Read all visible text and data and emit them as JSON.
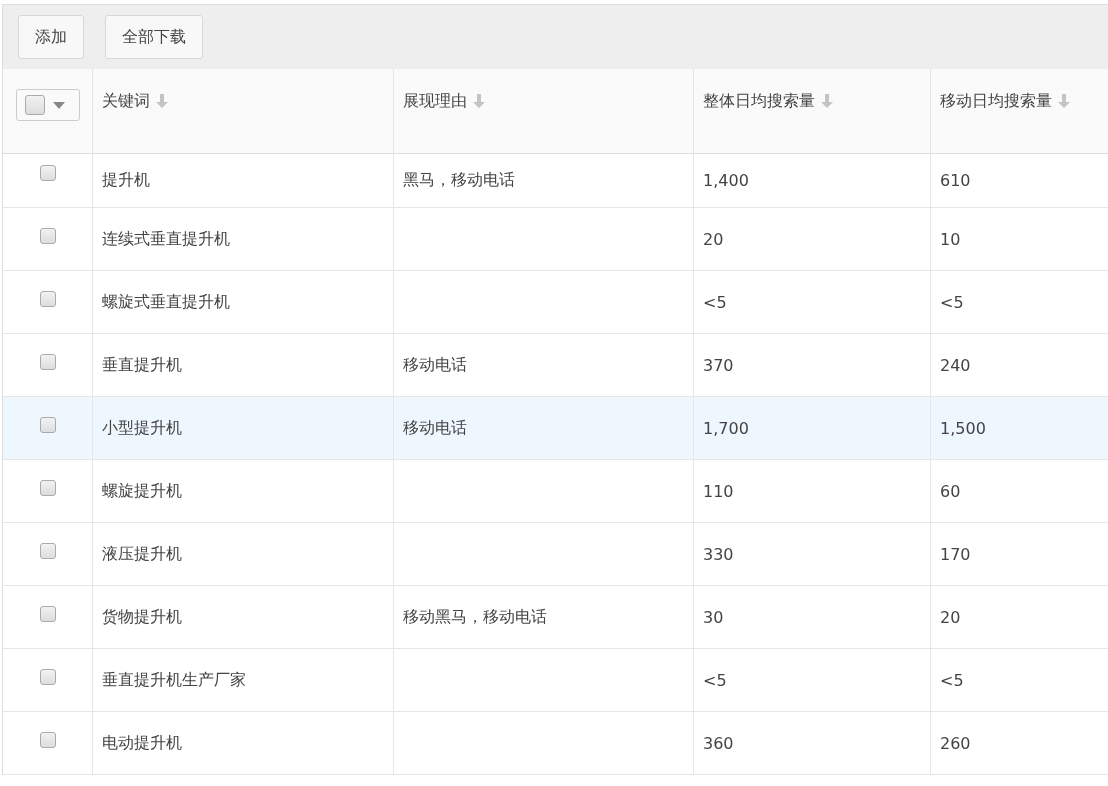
{
  "toolbar": {
    "buttons": [
      "添加",
      "全部下载"
    ]
  },
  "table": {
    "select_all": {
      "checked": false
    },
    "columns": [
      {
        "label": "关键词"
      },
      {
        "label": "展现理由"
      },
      {
        "label": "整体日均搜索量"
      },
      {
        "label": "移动日均搜索量"
      }
    ],
    "rows": [
      {
        "checked": false,
        "hovered": false,
        "cells": [
          "提升机",
          "黑马，移动电话",
          "1,400",
          "610"
        ]
      },
      {
        "checked": false,
        "hovered": false,
        "cells": [
          "连续式垂直提升机",
          "",
          "20",
          "10"
        ]
      },
      {
        "checked": false,
        "hovered": false,
        "cells": [
          "螺旋式垂直提升机",
          "",
          "<5",
          "<5"
        ]
      },
      {
        "checked": false,
        "hovered": false,
        "cells": [
          "垂直提升机",
          "移动电话",
          "370",
          "240"
        ]
      },
      {
        "checked": false,
        "hovered": true,
        "cells": [
          "小型提升机",
          "移动电话",
          "1,700",
          "1,500"
        ]
      },
      {
        "checked": false,
        "hovered": false,
        "cells": [
          "螺旋提升机",
          "",
          "110",
          "60"
        ]
      },
      {
        "checked": false,
        "hovered": false,
        "cells": [
          "液压提升机",
          "",
          "330",
          "170"
        ]
      },
      {
        "checked": false,
        "hovered": false,
        "cells": [
          "货物提升机",
          "移动黑马，移动电话",
          "30",
          "20"
        ]
      },
      {
        "checked": false,
        "hovered": false,
        "cells": [
          "垂直提升机生产厂家",
          "",
          "<5",
          "<5"
        ]
      },
      {
        "checked": false,
        "hovered": false,
        "cells": [
          "电动提升机",
          "",
          "360",
          "260"
        ]
      }
    ]
  }
}
